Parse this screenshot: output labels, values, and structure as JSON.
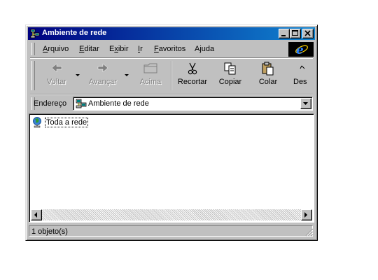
{
  "window": {
    "title": "Ambiente de rede",
    "controls": {
      "minimize": "minimize-icon",
      "maximize": "maximize-icon",
      "close": "close-icon"
    }
  },
  "menubar": {
    "items": [
      {
        "label": "Arquivo",
        "accel": "A",
        "rest": "rquivo"
      },
      {
        "label": "Editar",
        "accel": "E",
        "rest": "ditar"
      },
      {
        "label": "Exibir",
        "pre": "E",
        "accel": "x",
        "rest": "ibir"
      },
      {
        "label": "Ir",
        "accel": "I",
        "rest": "r"
      },
      {
        "label": "Favoritos",
        "accel": "F",
        "rest": "avoritos"
      },
      {
        "label": "Ajuda",
        "pre": "A",
        "accel": "j",
        "rest": "uda"
      }
    ],
    "brand_icon": "internet-explorer-logo"
  },
  "toolbar": {
    "buttons": [
      {
        "label": "Voltar",
        "icon": "back-arrow-icon",
        "enabled": false
      },
      {
        "label": "Avançar",
        "icon": "forward-arrow-icon",
        "enabled": false
      },
      {
        "label": "Acima",
        "icon": "up-folder-icon",
        "enabled": false
      },
      {
        "label": "Recortar",
        "icon": "scissors-icon",
        "enabled": true
      },
      {
        "label": "Copiar",
        "icon": "copy-icon",
        "enabled": true
      },
      {
        "label": "Colar",
        "icon": "paste-icon",
        "enabled": true
      },
      {
        "label": "Des",
        "icon": "undo-icon",
        "enabled": true
      }
    ]
  },
  "address": {
    "label": "Endereço",
    "value": "Ambiente de rede",
    "icon": "network-neighborhood-icon"
  },
  "content": {
    "items": [
      {
        "label": "Toda a rede",
        "icon": "entire-network-globe-icon"
      }
    ]
  },
  "statusbar": {
    "text": "1 objeto(s)"
  },
  "colors": {
    "titlebar_start": "#000080",
    "titlebar_end": "#1084d0",
    "face": "#c0c0c0"
  }
}
